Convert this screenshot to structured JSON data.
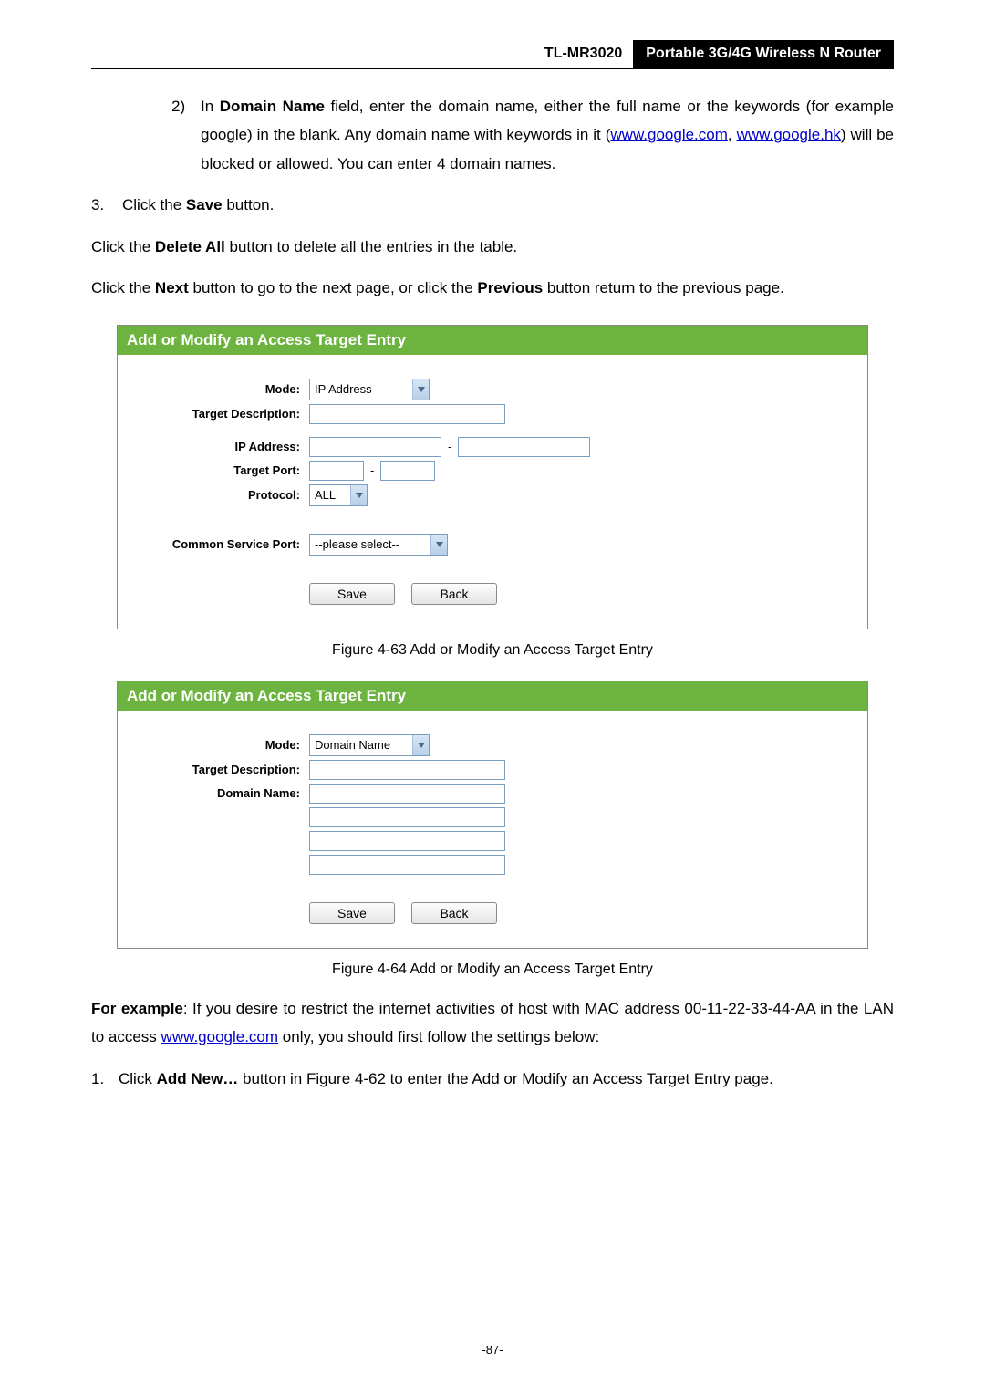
{
  "header": {
    "model": "TL-MR3020",
    "title": "Portable 3G/4G Wireless N Router"
  },
  "text": {
    "item2_prefix": "2)",
    "item2_1": "In ",
    "item2_bold1": "Domain Name",
    "item2_2": " field, enter the domain name, either the full name or the keywords (for example google) in the blank. Any domain name with keywords in it (",
    "item2_link1": "www.google.com",
    "item2_sep": ", ",
    "item2_link2": "www.google.hk",
    "item2_3": ") will be blocked or allowed. You can enter 4 domain names.",
    "item3_num": "3.",
    "item3_1": "Click the ",
    "item3_bold": "Save",
    "item3_2": " button.",
    "p_delete_1": "Click the ",
    "p_delete_bold": "Delete All",
    "p_delete_2": " button to delete all the entries in the table.",
    "p_next_1": "Click the ",
    "p_next_bold1": "Next",
    "p_next_2": " button to go to the next page, or click the ",
    "p_next_bold2": "Previous",
    "p_next_3": " button return to the previous page.",
    "example_bold": "For example",
    "example_1": ": If you desire to restrict the internet activities of host with MAC address 00-11-22-33-44-AA in the LAN to access ",
    "example_link": "www.google.com",
    "example_2": " only, you should first follow the settings below:",
    "ex_step1_num": "1.",
    "ex_step1_1": "Click ",
    "ex_step1_bold": "Add New…",
    "ex_step1_2": " button in Figure 4-62 to enter the Add or Modify an Access Target Entry page."
  },
  "form1": {
    "title": "Add or Modify an Access Target Entry",
    "labels": {
      "mode": "Mode:",
      "target_desc": "Target Description:",
      "ip": "IP Address:",
      "port": "Target Port:",
      "protocol": "Protocol:",
      "csp": "Common Service Port:"
    },
    "values": {
      "mode": "IP Address",
      "protocol": "ALL",
      "csp": "--please select--"
    },
    "buttons": {
      "save": "Save",
      "back": "Back"
    },
    "caption": "Figure 4-63    Add or Modify an Access Target Entry"
  },
  "form2": {
    "title": "Add or Modify an Access Target Entry",
    "labels": {
      "mode": "Mode:",
      "target_desc": "Target Description:",
      "domain": "Domain Name:"
    },
    "values": {
      "mode": "Domain Name"
    },
    "buttons": {
      "save": "Save",
      "back": "Back"
    },
    "caption": "Figure 4-64    Add or Modify an Access Target Entry"
  },
  "page_number": "-87-"
}
